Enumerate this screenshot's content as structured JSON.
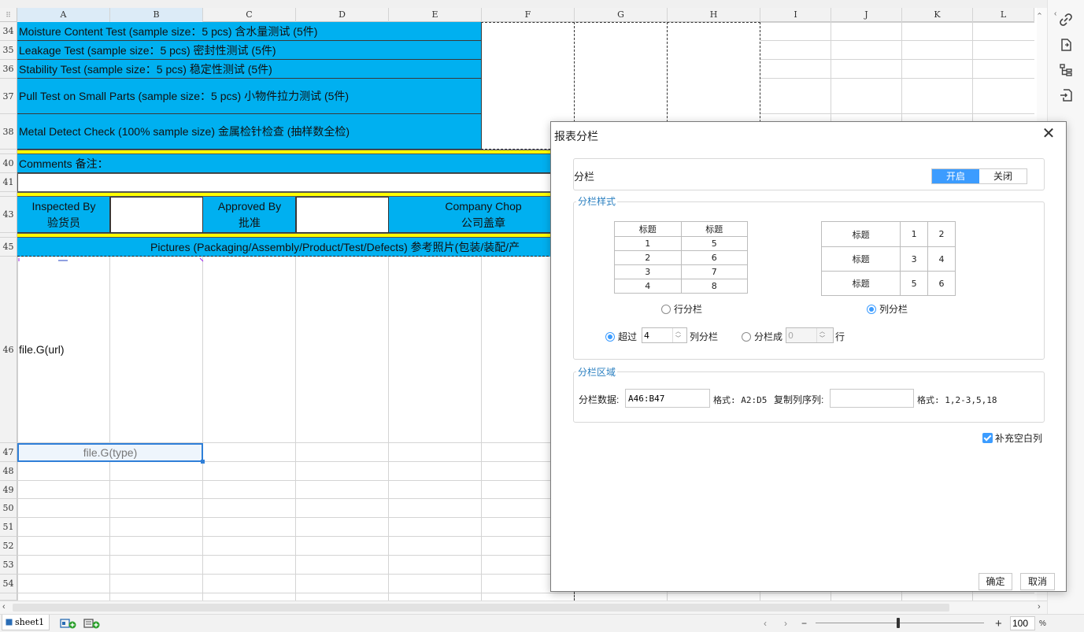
{
  "columns": [
    "A",
    "B",
    "C",
    "D",
    "E",
    "F",
    "G",
    "H",
    "I",
    "J",
    "K",
    "L"
  ],
  "rows": [
    "34",
    "35",
    "36",
    "37",
    "38",
    "40",
    "41",
    "43",
    "45",
    "46",
    "47",
    "48",
    "49",
    "50",
    "51",
    "52",
    "53",
    "54"
  ],
  "cells": {
    "r34": "Moisture Content Test (sample size：5 pcs)  含水量测试 (5件)",
    "r35": "Leakage Test (sample size：5 pcs)  密封性测试 (5件)",
    "r36": "Stability Test (sample size：5 pcs)  稳定性测试 (5件)",
    "r37": "Pull Test on Small Parts (sample size：5 pcs)  小物件拉力测试 (5件)",
    "r38": "Metal Detect Check (100% sample size)  金属检针检查 (抽样数全检)",
    "comments": "Comments  备注：",
    "inspected_en": "Inspected By",
    "inspected_cn": "验货员",
    "approved_en": "Approved By",
    "approved_cn": "批准",
    "chop_en": "Company Chop",
    "chop_cn": "公司盖章",
    "pictures": "Pictures (Packaging/Assembly/Product/Test/Defects)    参考照片(包装/装配/产",
    "url": "file.G(url)",
    "type": "file.G(type)"
  },
  "sheet": {
    "tab": "sheet1"
  },
  "zoom": {
    "value": "100",
    "unit": "%",
    "minus": "−",
    "plus": "+"
  },
  "dialog": {
    "title": "报表分栏",
    "close": "✕",
    "section_enable": "分栏",
    "toggle_on": "开启",
    "toggle_off": "关闭",
    "style_legend": "分栏样式",
    "row_preview": {
      "header": [
        "标题",
        "标题"
      ],
      "rows": [
        [
          "1",
          "5"
        ],
        [
          "2",
          "6"
        ],
        [
          "3",
          "7"
        ],
        [
          "4",
          "8"
        ]
      ]
    },
    "col_preview": {
      "rows": [
        [
          "标题",
          "1",
          "2"
        ],
        [
          "标题",
          "3",
          "4"
        ],
        [
          "标题",
          "5",
          "6"
        ]
      ]
    },
    "radio_row": "行分栏",
    "radio_col": "列分栏",
    "exceed_label": "超过",
    "exceed_value": "4",
    "exceed_suffix": "列分栏",
    "split_label": "分栏成",
    "split_value": "0",
    "split_suffix": "行",
    "area_legend": "分栏区域",
    "data_label": "分栏数据:",
    "data_value": "A46:B47",
    "format1": "格式: A2:D5",
    "copy_label": "复制列序列:",
    "copy_value": "",
    "format2": "格式: 1,2-3,5,18",
    "fill_blank": "补充空白列",
    "ok": "确定",
    "cancel": "取消"
  },
  "colors": {
    "accent": "#3c9cff",
    "cell_blue": "#00b0f0",
    "cell_yellow": "#ffff00",
    "selection": "#2f7fd8"
  }
}
